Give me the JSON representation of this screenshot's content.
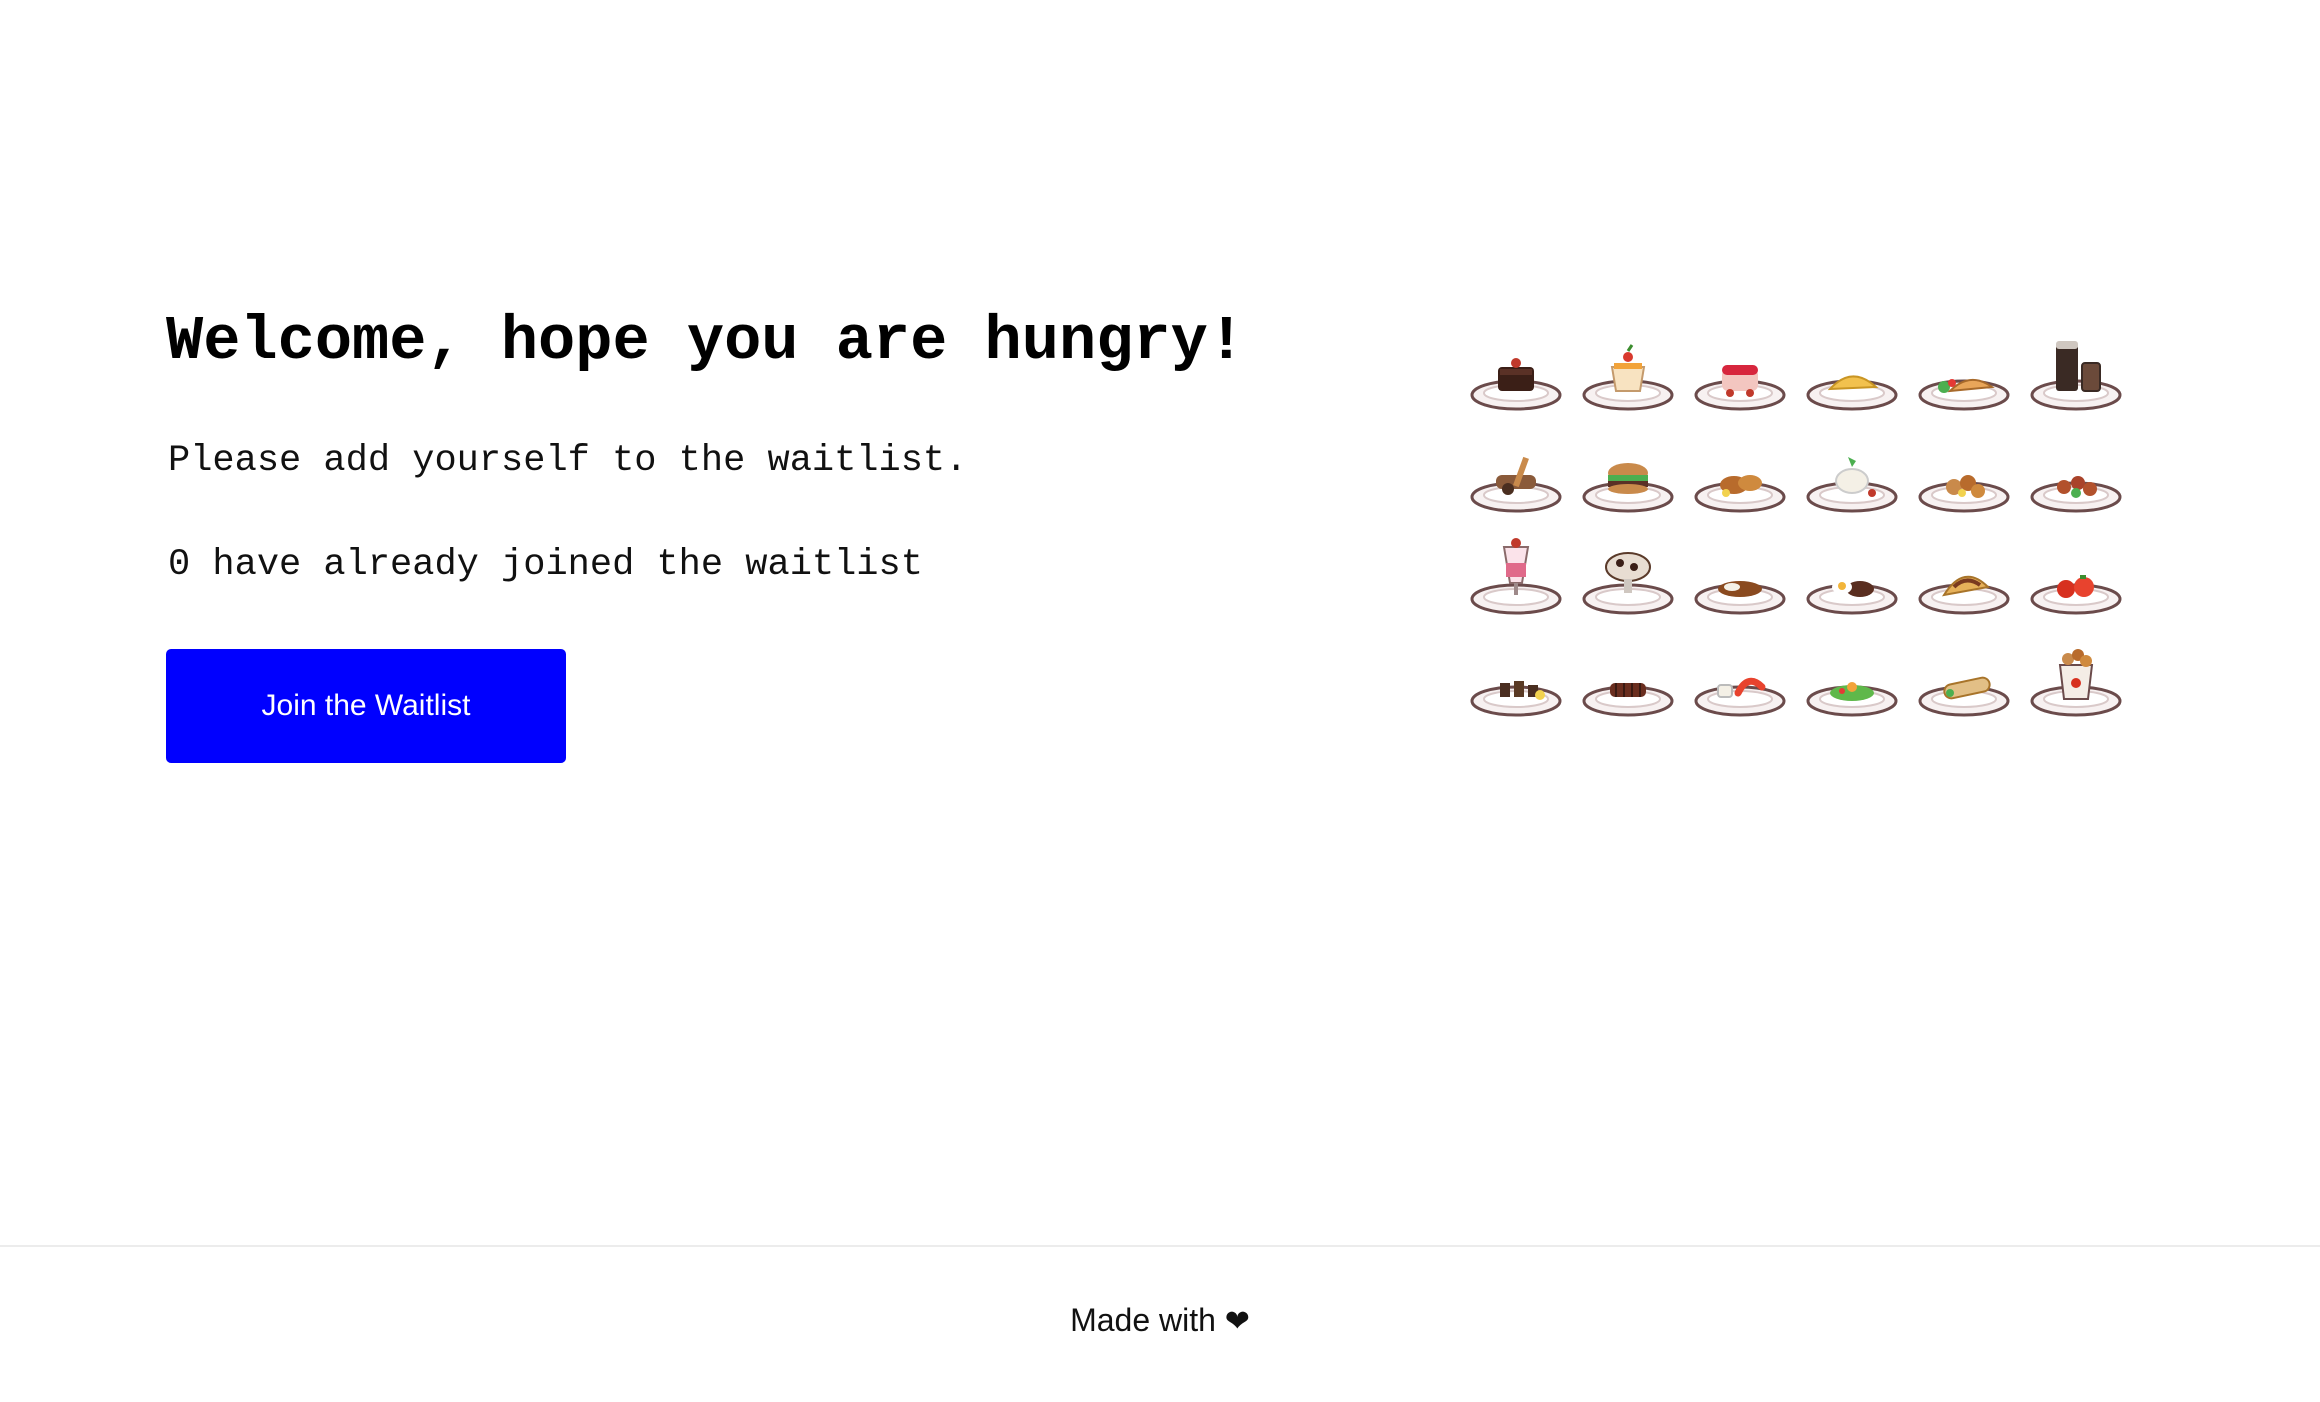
{
  "hero": {
    "title": "Welcome, hope you are hungry!",
    "subtitle": "Please add yourself to the waitlist.",
    "count_text": "0 have already joined the waitlist",
    "cta_label": "Join the Waitlist"
  },
  "colors": {
    "cta_background": "#0000ff",
    "cta_text": "#ffffff",
    "divider": "#ececec"
  },
  "food_grid": {
    "dishes": [
      {
        "icon": "chocolate-cake-icon"
      },
      {
        "icon": "pudding-icon"
      },
      {
        "icon": "strawberry-cake-icon"
      },
      {
        "icon": "omelette-icon"
      },
      {
        "icon": "crepe-salad-icon"
      },
      {
        "icon": "drinks-icon"
      },
      {
        "icon": "churros-icon"
      },
      {
        "icon": "burger-icon"
      },
      {
        "icon": "fried-chicken-icon"
      },
      {
        "icon": "rice-dish-icon"
      },
      {
        "icon": "nuggets-icon"
      },
      {
        "icon": "meatballs-icon"
      },
      {
        "icon": "milkshake-icon"
      },
      {
        "icon": "sundae-icon"
      },
      {
        "icon": "curry-icon"
      },
      {
        "icon": "steak-egg-icon"
      },
      {
        "icon": "taco-icon"
      },
      {
        "icon": "tomato-icon"
      },
      {
        "icon": "skewers-icon"
      },
      {
        "icon": "ribs-icon"
      },
      {
        "icon": "shrimp-icon"
      },
      {
        "icon": "salad-icon"
      },
      {
        "icon": "burrito-icon"
      },
      {
        "icon": "chicken-bucket-icon"
      }
    ]
  },
  "footer": {
    "text": "Made with",
    "heart": "❤"
  }
}
